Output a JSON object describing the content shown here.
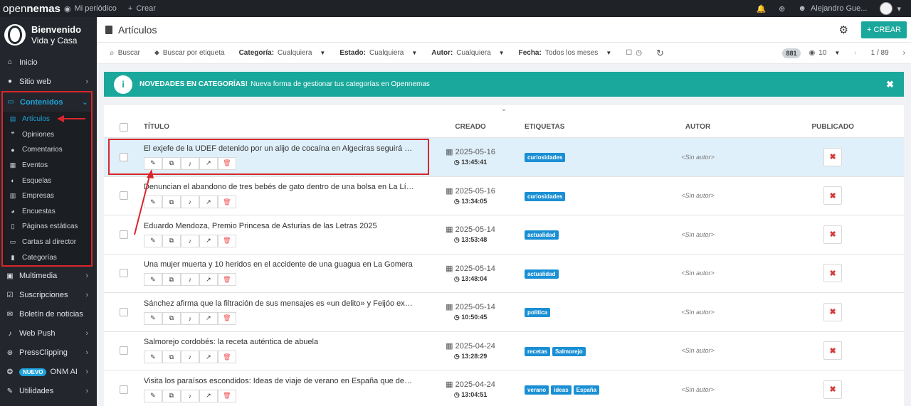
{
  "topbar": {
    "logo_light": "open",
    "logo_bold": "nemas",
    "my_paper": "Mi periódico",
    "create": "Crear",
    "user": "Alejandro Gue..."
  },
  "sidebar": {
    "welcome": "Bienvenido",
    "site": "Vida y Casa",
    "items_top": [
      {
        "label": "Inicio",
        "icon": "home-icon"
      },
      {
        "label": "Sitio web",
        "icon": "globe-icon"
      },
      {
        "label": "Contenidos",
        "icon": "content-icon"
      }
    ],
    "sub_items": [
      {
        "label": "Artículos",
        "icon": "file-icon"
      },
      {
        "label": "Opiniones",
        "icon": "quote-icon"
      },
      {
        "label": "Comentarios",
        "icon": "comment-icon"
      },
      {
        "label": "Eventos",
        "icon": "calendar-icon"
      },
      {
        "label": "Esquelas",
        "icon": "obituary-icon"
      },
      {
        "label": "Empresas",
        "icon": "building-icon"
      },
      {
        "label": "Encuestas",
        "icon": "pie-icon"
      },
      {
        "label": "Páginas estáticas",
        "icon": "page-icon"
      },
      {
        "label": "Cartas al director",
        "icon": "letter-icon"
      },
      {
        "label": "Categorías",
        "icon": "bookmark-icon"
      }
    ],
    "items_bottom": [
      {
        "label": "Multimedia",
        "icon": "image-icon"
      },
      {
        "label": "Suscripciones",
        "icon": "check-icon"
      },
      {
        "label": "Boletín de noticias",
        "icon": "mail-icon"
      },
      {
        "label": "Web Push",
        "icon": "bell-icon"
      },
      {
        "label": "PressClipping",
        "icon": "share-icon"
      },
      {
        "label": "ONM AI",
        "icon": "brain-icon",
        "badge": "NUEVO"
      },
      {
        "label": "Utilidades",
        "icon": "wrench-icon"
      }
    ]
  },
  "header": {
    "title": "Artículos",
    "create_button": "CREAR"
  },
  "filters": {
    "search": "Buscar",
    "tag_search": "Buscar por etiqueta",
    "category_label": "Categoría:",
    "category_value": "Cualquiera",
    "state_label": "Estado:",
    "state_value": "Cualquiera",
    "author_label": "Autor:",
    "author_value": "Cualquiera",
    "date_label": "Fecha:",
    "date_value": "Todos los meses",
    "total": "881",
    "per_page": "10",
    "pagination": "1 / 89"
  },
  "notice": {
    "bold": "NOVEDADES EN CATEGORÍAS!",
    "text": "Nueva forma de gestionar tus categorías en Opennemas"
  },
  "table": {
    "headers": {
      "title": "TÍTULO",
      "created": "CREADO",
      "tags": "ETIQUETAS",
      "author": "AUTOR",
      "published": "PUBLICADO"
    },
    "rows": [
      {
        "title": "El exjefe de la UDEF detenido por un alijo de cocaína en Algeciras seguirá en prisi...",
        "date": "2025-05-16",
        "time": "13:45:41",
        "tags": [
          "curiosidades"
        ],
        "author": "<Sin autor>"
      },
      {
        "title": "Denuncian el abandono de tres bebés de gato dentro de una bolsa en La Línea",
        "date": "2025-05-16",
        "time": "13:34:05",
        "tags": [
          "curiosidades"
        ],
        "author": "<Sin autor>"
      },
      {
        "title": "Eduardo Mendoza, Premio Princesa de Asturias de las Letras 2025",
        "date": "2025-05-14",
        "time": "13:53:48",
        "tags": [
          "actualidad"
        ],
        "author": "<Sin autor>"
      },
      {
        "title": "Una mujer muerta y 10 heridos en el accidente de una guagua en La Gomera",
        "date": "2025-05-14",
        "time": "13:48:04",
        "tags": [
          "actualidad"
        ],
        "author": "<Sin autor>"
      },
      {
        "title": "Sánchez afirma que la filtración de sus mensajes es «un delito» y Feijóo exige su ...",
        "date": "2025-05-14",
        "time": "10:50:45",
        "tags": [
          "politica"
        ],
        "author": "<Sin autor>"
      },
      {
        "title": "Salmorejo cordobés: la receta auténtica de abuela",
        "date": "2025-04-24",
        "time": "13:28:29",
        "tags": [
          "recetas",
          "Salmorejo"
        ],
        "author": "<Sin autor>"
      },
      {
        "title": "Visita los paraísos escondidos: Ideas de viaje de verano en España que debes con...",
        "date": "2025-04-24",
        "time": "13:04:51",
        "tags": [
          "verano",
          "ideas",
          "España"
        ],
        "author": "<Sin autor>"
      }
    ]
  },
  "colors": {
    "accent": "#1ba89c",
    "link": "#1fa3dc",
    "highlight": "#d9262c"
  }
}
